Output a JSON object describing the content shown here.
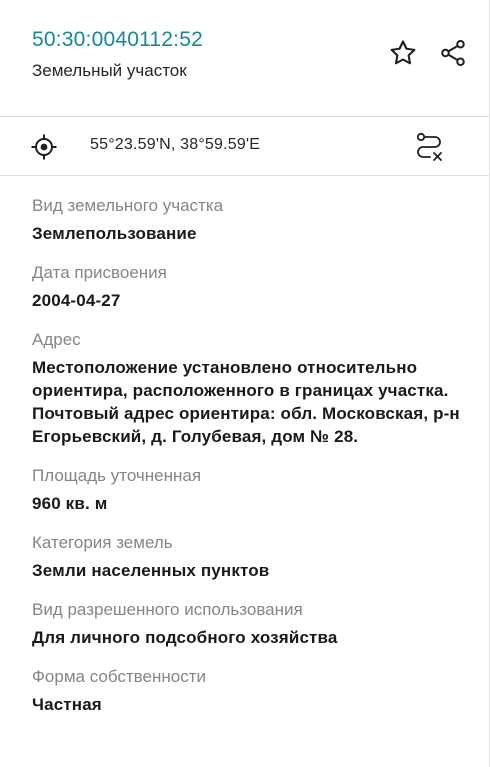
{
  "header": {
    "cadastral_number": "50:30:0040112:52",
    "object_type": "Земельный участок",
    "star_icon": "star-outline-icon",
    "share_icon": "share-icon"
  },
  "coords_bar": {
    "locate_icon": "locate-target-icon",
    "coordinates": "55°23.59'N, 38°59.59'E",
    "route_icon": "route-icon"
  },
  "fields": [
    {
      "label": "Вид земельного участка",
      "value": "Землепользование"
    },
    {
      "label": "Дата присвоения",
      "value": "2004-04-27"
    },
    {
      "label": "Адрес",
      "value": "Местоположение установлено относительно ориентира, расположенного в границах участка. Почтовый адрес ориентира: обл. Московская, р-н Егорьевский, д. Голубевая, дом № 28."
    },
    {
      "label": "Площадь уточненная",
      "value": "960 кв. м"
    },
    {
      "label": "Категория земель",
      "value": "Земли населенных пунктов"
    },
    {
      "label": "Вид разрешенного использования",
      "value": "Для личного подсобного хозяйства"
    },
    {
      "label": "Форма собственности",
      "value": "Частная"
    }
  ],
  "colors": {
    "accent": "#0f8a9a",
    "label": "#858585",
    "value": "#1a1a1a"
  }
}
